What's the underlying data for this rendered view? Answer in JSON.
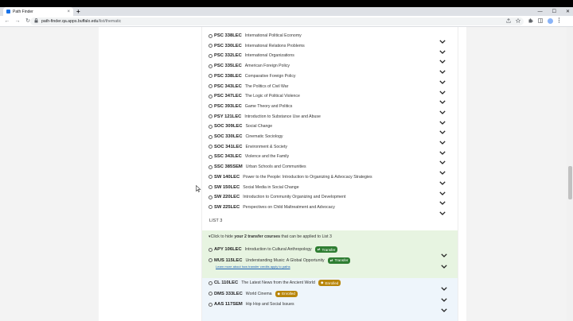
{
  "browser": {
    "tab_title": "Path Finder",
    "tab_close": "×",
    "new_tab": "+",
    "url_host": "path-finder.qa.apps.buffalo.edu",
    "url_path": "/list/thematic",
    "nav_back": "←",
    "nav_forward": "→",
    "nav_reload": "↻",
    "minimize": "—",
    "maximize": "☐",
    "close": "✕"
  },
  "courses": [
    {
      "code": "PSC 338LEC",
      "title": "International Political Economy"
    },
    {
      "code": "PSC 330LEC",
      "title": "International Relations Problems"
    },
    {
      "code": "PSC 332LEC",
      "title": "International Organizations"
    },
    {
      "code": "PSC 335LEC",
      "title": "American Foreign Policy"
    },
    {
      "code": "PSC 338LEC",
      "title": "Comparative Foreign Policy"
    },
    {
      "code": "PSC 343LEC",
      "title": "The Politics of Civil War"
    },
    {
      "code": "PSC 347LEC",
      "title": "The Logic of Political Violence"
    },
    {
      "code": "PSC 393LEC",
      "title": "Game Theory and Politics"
    },
    {
      "code": "PSY 121LEC",
      "title": "Introduction to Substance Use and Abuse"
    },
    {
      "code": "SOC 309LEC",
      "title": "Social Change"
    },
    {
      "code": "SOC 330LEC",
      "title": "Cinematic Sociology"
    },
    {
      "code": "SOC 341LEC",
      "title": "Environment & Society"
    },
    {
      "code": "SSC 343LEC",
      "title": "Violence and the Family"
    },
    {
      "code": "SSC 385SEM",
      "title": "Urban Schools and Communities"
    },
    {
      "code": "SW 140LEC",
      "title": "Power to the People: Introduction to Organizing & Advocacy Strategies"
    },
    {
      "code": "SW 150LEC",
      "title": "Social Media in Social Change"
    },
    {
      "code": "SW 220LEC",
      "title": "Introduction to Community Organizing and Development"
    },
    {
      "code": "SW 225LEC",
      "title": "Perspectives on Child Maltreatment and Advocacy"
    }
  ],
  "list3": {
    "label": "LIST 3",
    "toggle_prefix": "▾Click to hide ",
    "toggle_bold": "your 2 transfer courses",
    "toggle_suffix": " that can be applied to List 3",
    "transfer_courses": [
      {
        "code": "APY 106LEC",
        "title": "Introduction to Cultural Anthropology",
        "badge": "Transfer"
      },
      {
        "code": "MUS 115LEC",
        "title": "Understanding Music: A Global Opportunity",
        "badge": "Transfer"
      }
    ],
    "learn_more": "Learn more about how transfer credits apply to paths",
    "enrolled_courses": [
      {
        "code": "CL 110LEC",
        "title": "The Latest News from the Ancient World",
        "badge": "Enrolled"
      },
      {
        "code": "DMS 333LEC",
        "title": "World Cinema",
        "badge": "Enrolled"
      },
      {
        "code": "AAS 117SEM",
        "title": "Hip Hop and Social Issues",
        "badge": ""
      }
    ]
  },
  "colors": {
    "transfer_badge": "#2e7d32",
    "enrolled_badge": "#b8860b",
    "transfer_bg": "#e7f4e1"
  }
}
